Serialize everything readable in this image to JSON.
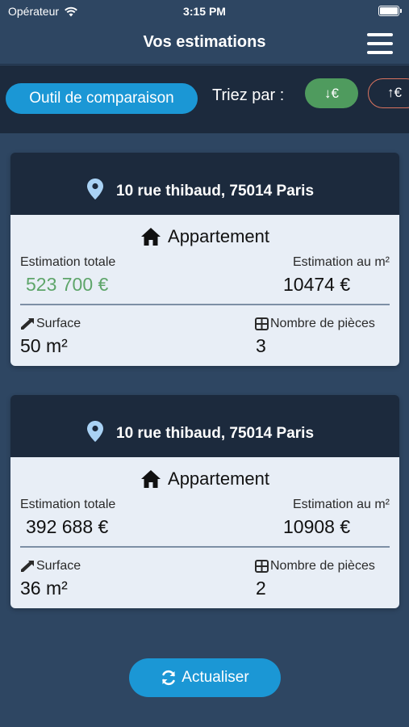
{
  "status_bar": {
    "carrier": "Opérateur",
    "time": "3:15 PM"
  },
  "header": {
    "title": "Vos estimations"
  },
  "toolbar": {
    "compare_label": "Outil de comparaison",
    "sort_label": "Triez par :",
    "sort_desc_label": "↓€",
    "sort_asc_label": "↑€"
  },
  "cards": [
    {
      "address": "10 rue thibaud, 75014 Paris",
      "type": "Appartement",
      "total_label": "Estimation totale",
      "total_value": "523 700 €",
      "m2_label": "Estimation au m²",
      "m2_value": "10474 €",
      "surface_label": "Surface",
      "surface_value": "50 m²",
      "rooms_label": "Nombre de pièces",
      "rooms_value": "3"
    },
    {
      "address": "10 rue thibaud, 75014 Paris",
      "type": "Appartement",
      "total_label": "Estimation totale",
      "total_value": "392 688 €",
      "m2_label": "Estimation au m²",
      "m2_value": "10908 €",
      "surface_label": "Surface",
      "surface_value": "36 m²",
      "rooms_label": "Nombre de pièces",
      "rooms_value": "2"
    }
  ],
  "refresh_label": "Actualiser",
  "colors": {
    "background": "#2e4662",
    "dark_panel": "#1c2a3d",
    "accent_blue": "#1b97d5",
    "green": "#4f9b5e",
    "orange_outline": "#d9735f",
    "card_body": "#e8eef6"
  }
}
